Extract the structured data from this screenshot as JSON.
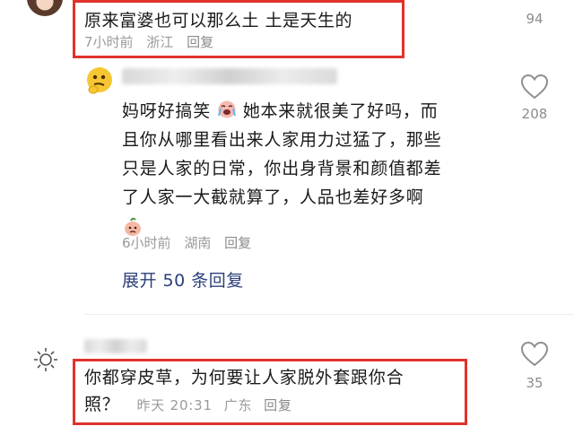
{
  "comments": [
    {
      "text": "原来富婆也可以那么土 土是天生的",
      "time": "7小时前",
      "location": "浙江",
      "reply_label": "回复",
      "likes": "94"
    },
    {
      "text_line1": "妈呀好搞笑",
      "text_line1b": "她本来就很美了好吗，而",
      "text_line2": "且你从哪里看出来人家用力过猛了，那些",
      "text_line3": "只是人家的日常，你出身背景和颜值都差",
      "text_line4": "了人家一大截就算了，人品也差好多啊",
      "time": "6小时前",
      "location": "湖南",
      "reply_label": "回复",
      "likes": "208",
      "expand_label": "展开 50 条回复"
    },
    {
      "text_line1": "你都穿皮草，为何要让人家脱外套跟你合",
      "text_line2": "照？",
      "time": "昨天 20:31",
      "location": "广东",
      "reply_label": "回复",
      "likes": "35"
    }
  ],
  "colors": {
    "highlight": "#e0322c",
    "divider": "#eeeeee",
    "meta": "#9a9a9a",
    "expand": "#2b3f7a"
  }
}
